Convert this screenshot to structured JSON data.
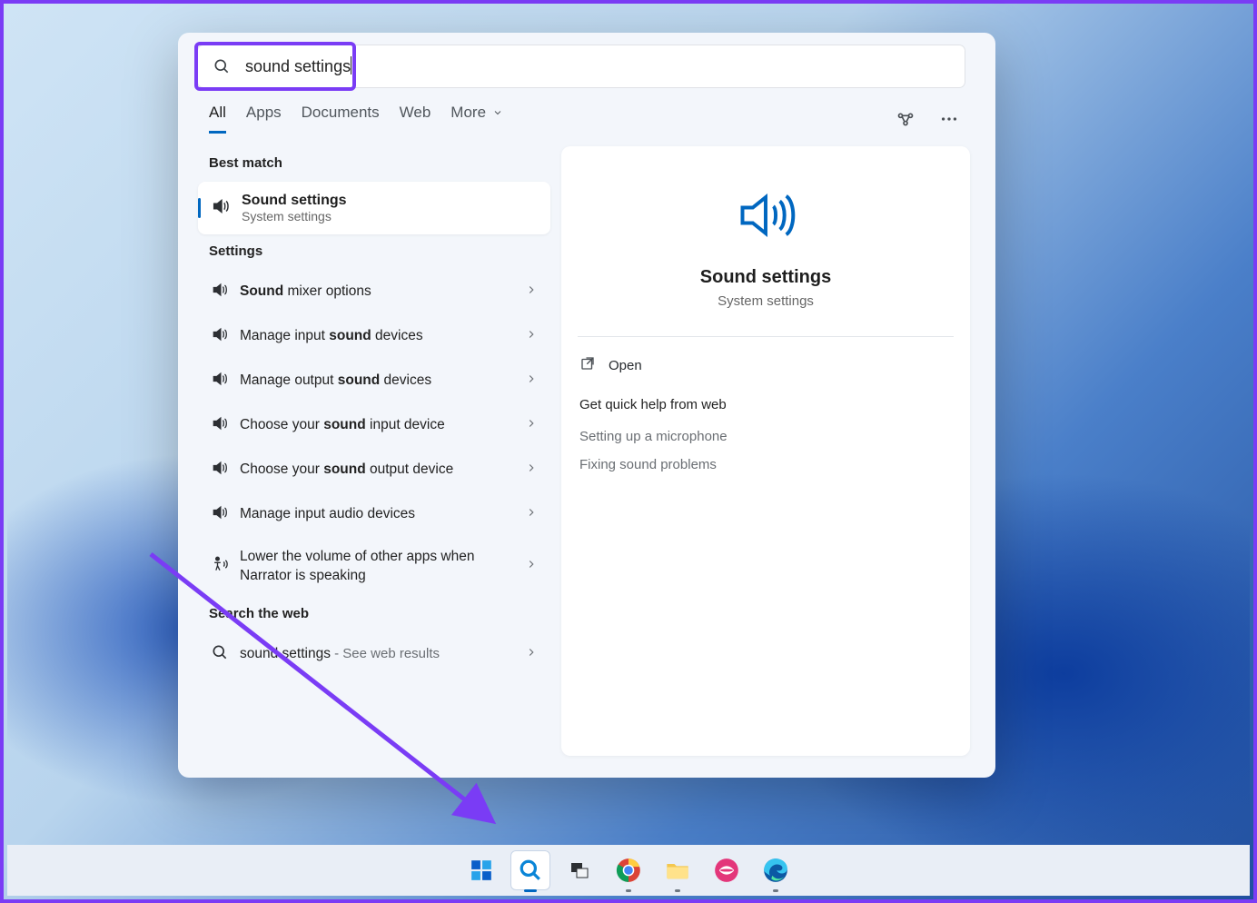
{
  "search": {
    "query": "sound settings"
  },
  "tabs": {
    "items": [
      "All",
      "Apps",
      "Documents",
      "Web"
    ],
    "more": "More",
    "active_index": 0
  },
  "left": {
    "best_match_label": "Best match",
    "best_match": {
      "title": "Sound settings",
      "subtitle": "System settings"
    },
    "settings_label": "Settings",
    "settings_items": [
      {
        "pre": "",
        "bold": "Sound",
        "post": " mixer options",
        "icon": "speaker"
      },
      {
        "pre": "Manage input ",
        "bold": "sound",
        "post": " devices",
        "icon": "speaker"
      },
      {
        "pre": "Manage output ",
        "bold": "sound",
        "post": " devices",
        "icon": "speaker"
      },
      {
        "pre": "Choose your ",
        "bold": "sound",
        "post": " input device",
        "icon": "speaker"
      },
      {
        "pre": "Choose your ",
        "bold": "sound",
        "post": " output device",
        "icon": "speaker"
      },
      {
        "pre": "Manage input audio devices",
        "bold": "",
        "post": "",
        "icon": "speaker"
      },
      {
        "pre": "Lower the volume of other apps when Narrator is speaking",
        "bold": "",
        "post": "",
        "icon": "accessibility"
      }
    ],
    "web_label": "Search the web",
    "web_item": {
      "query": "sound settings",
      "suffix": " - See web results"
    }
  },
  "right": {
    "title": "Sound settings",
    "subtitle": "System settings",
    "open_label": "Open",
    "help_label": "Get quick help from web",
    "help_links": [
      "Setting up a microphone",
      "Fixing sound problems"
    ]
  },
  "taskbar": {
    "items": [
      {
        "name": "start",
        "color": "#0067c0"
      },
      {
        "name": "search",
        "color": "#0067c0",
        "active": true
      },
      {
        "name": "task-view",
        "color": "#3a3f44"
      },
      {
        "name": "chrome",
        "color": "#db4437",
        "running": true
      },
      {
        "name": "file-explorer",
        "color": "#f3c74f",
        "running": true
      },
      {
        "name": "lips-app",
        "color": "#e3367a"
      },
      {
        "name": "edge",
        "color": "#1592d6",
        "running": true
      }
    ]
  },
  "annotation": {
    "highlight_color": "#7a3cf5"
  }
}
